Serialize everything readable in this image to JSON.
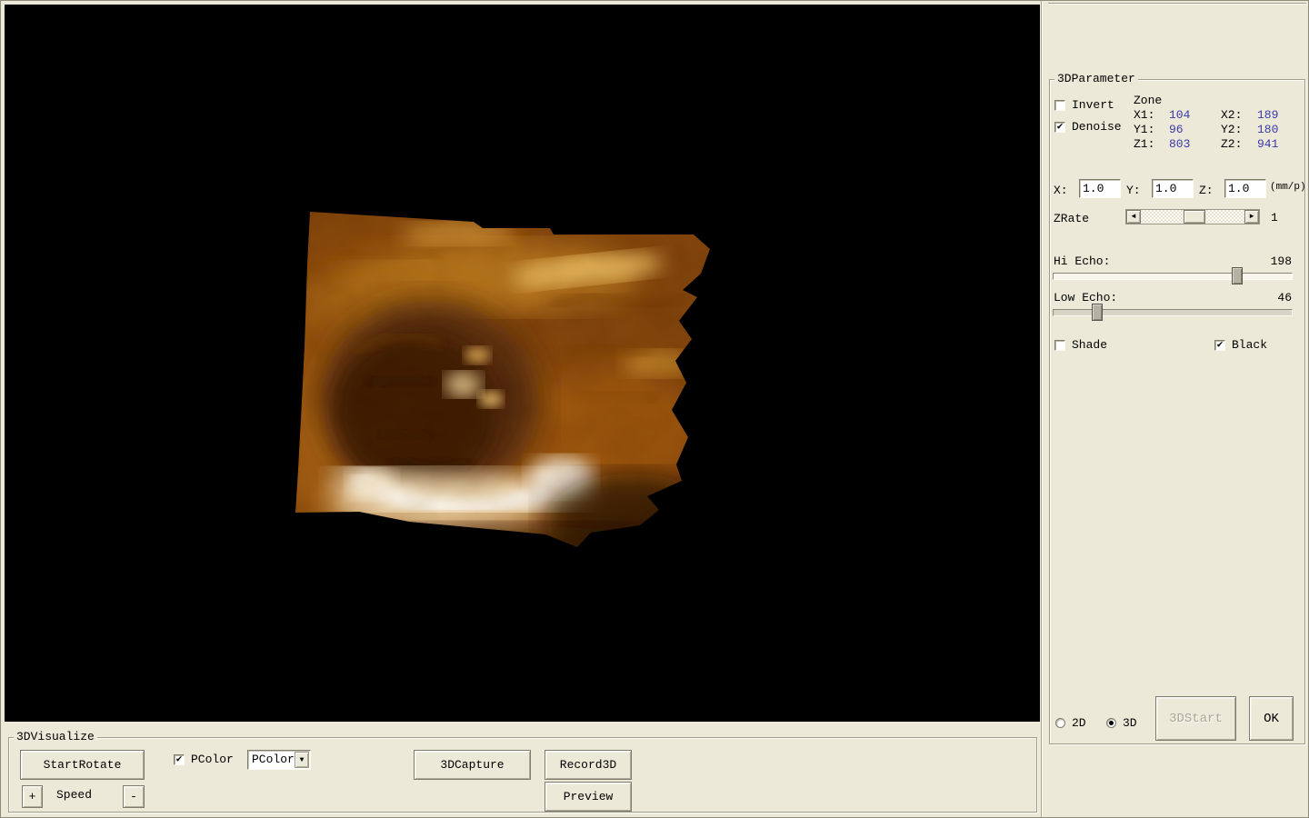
{
  "window": {
    "bg_color": "#ece9d8",
    "viewport_bg": "#000000",
    "value_color": "#3939a8"
  },
  "viewport": {
    "description": "3D ultrasound volume render of fetal face, amber colormap"
  },
  "param": {
    "title": "3DParameter",
    "invert": {
      "label": "Invert",
      "checked": false
    },
    "denoise": {
      "label": "Denoise",
      "checked": true
    },
    "zone": {
      "label": "Zone",
      "rows": [
        {
          "l1": "X1:",
          "v1": "104",
          "l2": "X2:",
          "v2": "189"
        },
        {
          "l1": "Y1:",
          "v1": "96",
          "l2": "Y2:",
          "v2": "180"
        },
        {
          "l1": "Z1:",
          "v1": "803",
          "l2": "Z2:",
          "v2": "941"
        }
      ]
    },
    "spacing": {
      "x_label": "X:",
      "x_value": "1.0",
      "y_label": "Y:",
      "y_value": "1.0",
      "z_label": "Z:",
      "z_value": "1.0",
      "unit": "(mm/p)"
    },
    "zrate": {
      "label": "ZRate",
      "value": "1"
    },
    "hi_echo": {
      "label": "Hi Echo:",
      "value": "198",
      "max": 255
    },
    "low_echo": {
      "label": "Low Echo:",
      "value": "46",
      "max": 255
    },
    "shade": {
      "label": "Shade",
      "checked": false
    },
    "black": {
      "label": "Black",
      "checked": true
    },
    "mode_2d": {
      "label": "2D",
      "selected": false
    },
    "mode_3d": {
      "label": "3D",
      "selected": true
    },
    "start_button": {
      "label": "3DStart",
      "disabled": true
    },
    "ok_button": {
      "label": "OK"
    }
  },
  "visualize": {
    "title": "3DVisualize",
    "start_rotate": "StartRotate",
    "pcolor_check": {
      "label": "PColor",
      "checked": true
    },
    "pcolor_combo": {
      "value": "PColor"
    },
    "speed": {
      "plus": "+",
      "label": "Speed",
      "minus": "-"
    },
    "capture_button": "3DCapture",
    "record_button": "Record3D",
    "preview_button": "Preview"
  },
  "icons": {
    "check": "✔",
    "combo_arrow": "▼",
    "scroll_left": "◄",
    "scroll_right": "►"
  }
}
